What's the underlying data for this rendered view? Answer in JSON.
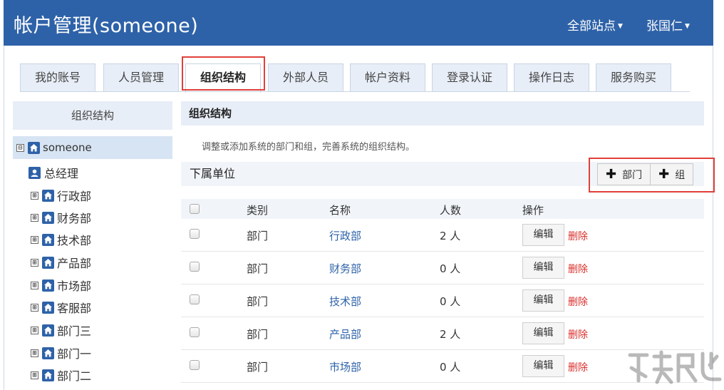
{
  "header": {
    "title": "帐户管理(someone)",
    "all_sites": "全部站点",
    "user": "张国仁",
    "bg_color": "#2e62a8"
  },
  "tabs": [
    {
      "label": "我的账号"
    },
    {
      "label": "人员管理"
    },
    {
      "label": "组织结构",
      "active": true
    },
    {
      "label": "外部人员"
    },
    {
      "label": "帐户资料"
    },
    {
      "label": "登录认证"
    },
    {
      "label": "操作日志"
    },
    {
      "label": "服务购买"
    }
  ],
  "sidebar": {
    "title": "组织结构",
    "root": {
      "label": "someone",
      "expander": "⊟",
      "icon": "home-icon"
    },
    "manager": {
      "label": "总经理",
      "icon": "person-icon"
    },
    "departments": [
      {
        "label": "行政部",
        "expander": "⊞"
      },
      {
        "label": "财务部",
        "expander": "⊞"
      },
      {
        "label": "技术部",
        "expander": "⊞"
      },
      {
        "label": "产品部",
        "expander": "⊞"
      },
      {
        "label": "市场部",
        "expander": "⊞"
      },
      {
        "label": "客服部",
        "expander": "⊞"
      },
      {
        "label": "部门三",
        "expander": "⊞"
      },
      {
        "label": "部门一",
        "expander": "⊞"
      },
      {
        "label": "部门二",
        "expander": "⊞"
      }
    ]
  },
  "main": {
    "section_title": "组织结构",
    "description": "调整或添加系统的部门和组，完善系统的组织结构。",
    "sub_title": "下属单位",
    "add_dept": "部门",
    "add_group": "组",
    "plus": "✚",
    "columns": {
      "type": "类别",
      "name": "名称",
      "count": "人数",
      "ops": "操作"
    },
    "rows": [
      {
        "type": "部门",
        "name": "行政部",
        "count": "2 人",
        "edit": "编辑",
        "delete": "删除"
      },
      {
        "type": "部门",
        "name": "财务部",
        "count": "0 人",
        "edit": "编辑",
        "delete": "删除"
      },
      {
        "type": "部门",
        "name": "技术部",
        "count": "0 人",
        "edit": "编辑",
        "delete": "删除"
      },
      {
        "type": "部门",
        "name": "产品部",
        "count": "2 人",
        "edit": "编辑",
        "delete": "删除"
      },
      {
        "type": "部门",
        "name": "市场部",
        "count": "0 人",
        "edit": "编辑",
        "delete": "删除"
      }
    ]
  },
  "highlight_color": "#e0403a"
}
